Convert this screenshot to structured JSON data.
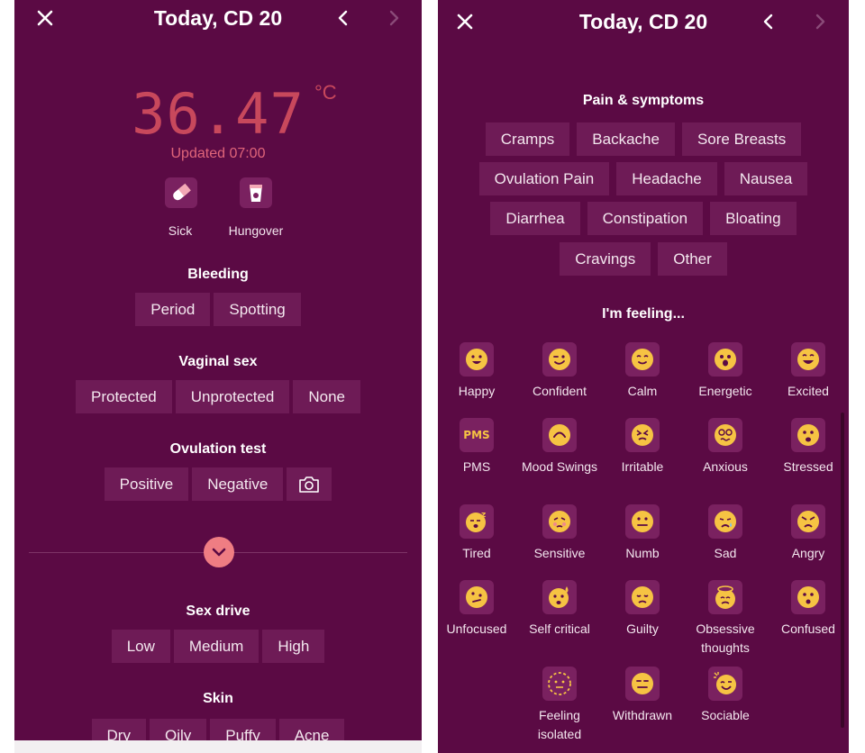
{
  "left": {
    "header": {
      "title": "Today, CD 20"
    },
    "temperature": {
      "value": "36.47",
      "unit": "°C",
      "updated": "Updated 07:00"
    },
    "quick_tags": [
      {
        "label": "Sick",
        "icon": "pill-icon"
      },
      {
        "label": "Hungover",
        "icon": "cup-icon"
      }
    ],
    "bleeding": {
      "title": "Bleeding",
      "options": [
        "Period",
        "Spotting"
      ]
    },
    "vaginal_sex": {
      "title": "Vaginal sex",
      "options": [
        "Protected",
        "Unprotected",
        "None"
      ]
    },
    "ovulation_test": {
      "title": "Ovulation test",
      "options": [
        "Positive",
        "Negative"
      ]
    },
    "sex_drive": {
      "title": "Sex drive",
      "options": [
        "Low",
        "Medium",
        "High"
      ]
    },
    "skin": {
      "title": "Skin",
      "options": [
        "Dry",
        "Oily",
        "Puffy",
        "Acne"
      ]
    }
  },
  "right": {
    "header": {
      "title": "Today, CD 20"
    },
    "pain": {
      "title": "Pain & symptoms",
      "rows": [
        [
          "Cramps",
          "Backache",
          "Sore Breasts"
        ],
        [
          "Ovulation Pain",
          "Headache",
          "Nausea"
        ],
        [
          "Diarrhea",
          "Constipation",
          "Bloating"
        ],
        [
          "Cravings",
          "Other"
        ]
      ]
    },
    "feeling": {
      "title": "I'm feeling...",
      "moods": [
        {
          "label": "Happy",
          "icon": "happy-face-icon"
        },
        {
          "label": "Confident",
          "icon": "confident-face-icon"
        },
        {
          "label": "Calm",
          "icon": "calm-face-icon"
        },
        {
          "label": "Energetic",
          "icon": "energetic-face-icon"
        },
        {
          "label": "Excited",
          "icon": "excited-face-icon"
        },
        {
          "label": "PMS",
          "icon": "pms-icon",
          "glyph": "PMS"
        },
        {
          "label": "Mood Swings",
          "icon": "mood-swings-face-icon"
        },
        {
          "label": "Irritable",
          "icon": "irritable-face-icon"
        },
        {
          "label": "Anxious",
          "icon": "anxious-face-icon"
        },
        {
          "label": "Stressed",
          "icon": "stressed-face-icon"
        },
        {
          "label": "Tired",
          "icon": "tired-face-icon"
        },
        {
          "label": "Sensitive",
          "icon": "sensitive-face-icon"
        },
        {
          "label": "Numb",
          "icon": "numb-face-icon"
        },
        {
          "label": "Sad",
          "icon": "sad-face-icon"
        },
        {
          "label": "Angry",
          "icon": "angry-face-icon"
        },
        {
          "label": "Unfocused",
          "icon": "unfocused-face-icon"
        },
        {
          "label": "Self critical",
          "icon": "self-critical-face-icon"
        },
        {
          "label": "Guilty",
          "icon": "guilty-face-icon"
        },
        {
          "label": "Obsessive thoughts",
          "icon": "obsessive-face-icon"
        },
        {
          "label": "Confused",
          "icon": "confused-face-icon"
        },
        {
          "label": "Feeling isolated",
          "icon": "isolated-face-icon"
        },
        {
          "label": "Withdrawn",
          "icon": "withdrawn-face-icon"
        },
        {
          "label": "Sociable",
          "icon": "sociable-face-icon"
        }
      ]
    }
  },
  "colors": {
    "background": "#5b0a44",
    "chip": "#6e1b56",
    "temperature": "#c8485c",
    "accent": "#ef7d83",
    "emoji": "#f6c343"
  }
}
